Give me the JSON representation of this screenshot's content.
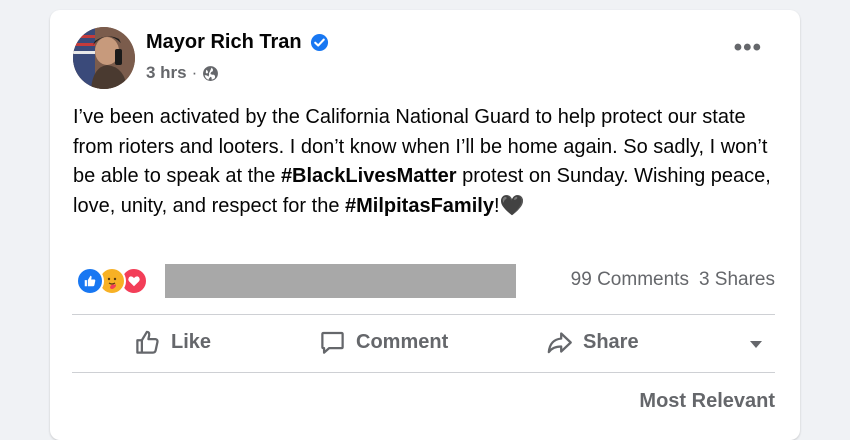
{
  "post": {
    "author": "Mayor Rich Tran",
    "time": "3 hrs",
    "separator": "·",
    "more_label": "•••",
    "text_segments": [
      {
        "text": "I’ve been activated by the California National Guard to help protect our state from rioters and looters. I don’t know when I’ll be home again. So sadly, I won’t be able to speak at the ",
        "bold": false
      },
      {
        "text": "#BlackLivesMatter",
        "bold": true
      },
      {
        "text": " protest on Sunday. Wishing peace, love, unity, and respect for the ",
        "bold": false
      },
      {
        "text": "#MilpitasFamily",
        "bold": true
      },
      {
        "text": "!",
        "bold": false
      }
    ],
    "emoji": "🖤",
    "icons": {
      "verified": "verified-badge-icon",
      "audience": "globe-icon",
      "reactions": [
        "like-icon",
        "care-icon",
        "love-icon"
      ]
    }
  },
  "stats": {
    "comments": "99 Comments",
    "shares": "3 Shares"
  },
  "actions": {
    "like": "Like",
    "comment": "Comment",
    "share": "Share"
  },
  "comments": {
    "sort_label": "Most Relevant"
  },
  "colors": {
    "background": "#f0f2f5",
    "card": "#ffffff",
    "secondary_text": "#65676b",
    "verified_blue": "#1877f2",
    "like_blue": "#1877f2",
    "love_red": "#f33e58",
    "care_yellow": "#f7b125",
    "redaction": "#a8a8a8"
  }
}
